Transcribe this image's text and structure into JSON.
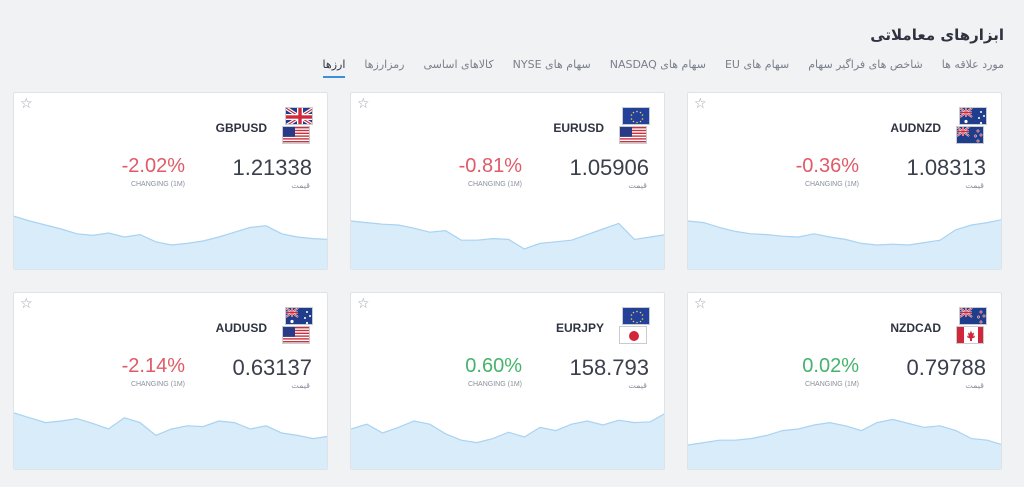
{
  "page": {
    "title": "ابزارهای معاملاتی"
  },
  "tabs": [
    {
      "label": "ارزها",
      "active": true
    },
    {
      "label": "رمزارزها",
      "active": false
    },
    {
      "label": "کالاهای اساسی",
      "active": false
    },
    {
      "label": "سهام های NYSE",
      "active": false
    },
    {
      "label": "سهام های NASDAQ",
      "active": false
    },
    {
      "label": "سهام های EU",
      "active": false
    },
    {
      "label": "شاخص های فراگیر سهام",
      "active": false
    },
    {
      "label": "مورد علاقه ها",
      "active": false
    }
  ],
  "colors": {
    "negative": "#e05a67",
    "positive": "#45b36b",
    "accent": "#3d8fd8",
    "chart_fill": "#d8ecfa",
    "chart_line": "#a9d3f2"
  },
  "cards": [
    {
      "pair": "AUDNZD",
      "price": "1.08313",
      "price_label": "قیمت",
      "change": "-0.36%",
      "change_label": "CHANGING (1M)",
      "trend": "negative",
      "flags": [
        "australia-flag",
        "new-zealand-flag"
      ],
      "chart_data": {
        "type": "area",
        "values": [
          60,
          58,
          52,
          47,
          44,
          43,
          41,
          40,
          44,
          40,
          37,
          32,
          30,
          31,
          30,
          33,
          36,
          49,
          55,
          58,
          62
        ]
      }
    },
    {
      "pair": "EURUSD",
      "price": "1.05906",
      "price_label": "قیمت",
      "change": "-0.81%",
      "change_label": "CHANGING (1M)",
      "trend": "negative",
      "flags": [
        "european-union-flag",
        "united-states-flag"
      ],
      "chart_data": {
        "type": "area",
        "values": [
          60,
          58,
          56,
          55,
          51,
          46,
          48,
          36,
          36,
          38,
          37,
          25,
          32,
          34,
          36,
          43,
          50,
          57,
          37,
          40,
          43
        ]
      }
    },
    {
      "pair": "GBPUSD",
      "price": "1.21338",
      "price_label": "قیمت",
      "change": "-2.02%",
      "change_label": "CHANGING (1M)",
      "trend": "negative",
      "flags": [
        "united-kingdom-flag",
        "united-states-flag"
      ],
      "chart_data": {
        "type": "area",
        "values": [
          66,
          60,
          55,
          50,
          44,
          42,
          45,
          40,
          43,
          34,
          30,
          32,
          35,
          40,
          46,
          52,
          54,
          44,
          40,
          38,
          37
        ]
      }
    },
    {
      "pair": "NZDCAD",
      "price": "0.79788",
      "price_label": "قیمت",
      "change": "0.02%",
      "change_label": "CHANGING (1M)",
      "trend": "positive",
      "flags": [
        "new-zealand-flag",
        "canada-flag"
      ],
      "chart_data": {
        "type": "area",
        "values": [
          30,
          33,
          36,
          36,
          38,
          42,
          48,
          50,
          55,
          58,
          54,
          48,
          58,
          62,
          57,
          52,
          54,
          48,
          38,
          36,
          30
        ]
      }
    },
    {
      "pair": "EURJPY",
      "price": "158.793",
      "price_label": "قیمت",
      "change": "0.60%",
      "change_label": "CHANGING (1M)",
      "trend": "positive",
      "flags": [
        "european-union-flag",
        "japan-flag"
      ],
      "chart_data": {
        "type": "area",
        "values": [
          50,
          56,
          45,
          52,
          60,
          56,
          44,
          36,
          33,
          38,
          46,
          40,
          52,
          48,
          56,
          60,
          55,
          61,
          58,
          59,
          70
        ]
      }
    },
    {
      "pair": "AUDUSD",
      "price": "0.63137",
      "price_label": "قیمت",
      "change": "-2.14%",
      "change_label": "CHANGING (1M)",
      "trend": "negative",
      "flags": [
        "australia-flag",
        "united-states-flag"
      ],
      "chart_data": {
        "type": "area",
        "values": [
          70,
          64,
          58,
          60,
          63,
          57,
          50,
          64,
          58,
          42,
          50,
          54,
          53,
          60,
          58,
          50,
          54,
          45,
          42,
          38,
          41
        ]
      }
    }
  ]
}
